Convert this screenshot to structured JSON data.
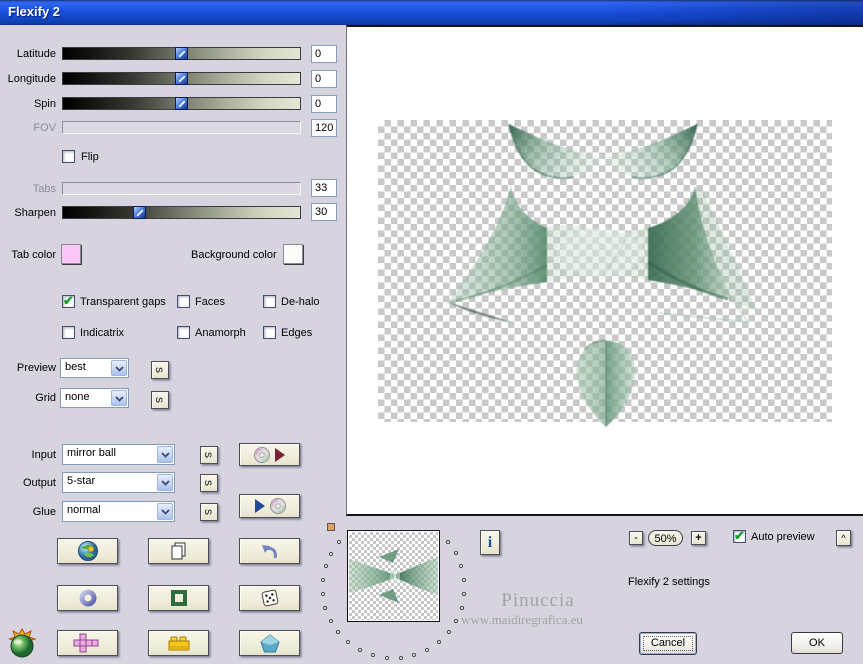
{
  "window": {
    "title": "Flexify 2"
  },
  "sliders": [
    {
      "label": "Latitude",
      "value": "0",
      "enabled": true,
      "pos": 0.495
    },
    {
      "label": "Longitude",
      "value": "0",
      "enabled": true,
      "pos": 0.495
    },
    {
      "label": "Spin",
      "value": "0",
      "enabled": true,
      "pos": 0.495
    },
    {
      "label": "FOV",
      "value": "120",
      "enabled": false,
      "pos": 0
    },
    {
      "label": "Tabs",
      "value": "33",
      "enabled": false,
      "pos": 0
    },
    {
      "label": "Sharpen",
      "value": "30",
      "enabled": true,
      "pos": 0.31
    }
  ],
  "flip": {
    "label": "Flip",
    "checked": false
  },
  "colors": {
    "tab_label": "Tab color",
    "tab_value": "#f9c6f6",
    "bg_label": "Background color",
    "bg_value": "#fcfcf8"
  },
  "checkboxes": [
    {
      "label": "Transparent gaps",
      "checked": true
    },
    {
      "label": "Faces",
      "checked": false
    },
    {
      "label": "De-halo",
      "checked": false
    },
    {
      "label": "Indicatrix",
      "checked": false
    },
    {
      "label": "Anamorph",
      "checked": false
    },
    {
      "label": "Edges",
      "checked": false
    }
  ],
  "dropdowns": {
    "preview": {
      "label": "Preview",
      "value": "best"
    },
    "grid": {
      "label": "Grid",
      "value": "none"
    },
    "input": {
      "label": "Input",
      "value": "mirror ball"
    },
    "output": {
      "label": "Output",
      "value": "5-star"
    },
    "glue": {
      "label": "Glue",
      "value": "normal"
    }
  },
  "seed_button_label": "s",
  "info_button_label": "i",
  "zoom": {
    "minus": "-",
    "level": "50%",
    "plus": "+"
  },
  "auto_preview": {
    "label": "Auto preview",
    "checked": true
  },
  "settings_text": "Flexify 2 settings",
  "watermark": {
    "line1": "Pinuccia",
    "line2": "www.maidiregrafica.eu"
  },
  "actions": {
    "cancel": "Cancel",
    "ok": "OK",
    "collapse": "^"
  }
}
